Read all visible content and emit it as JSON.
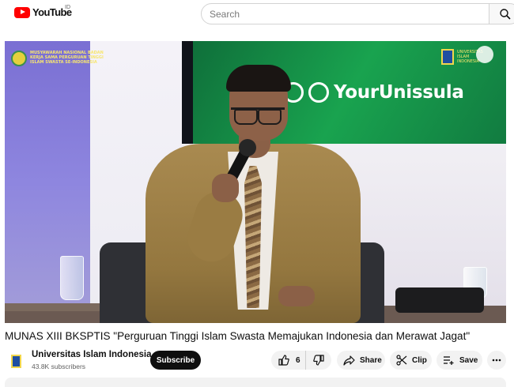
{
  "header": {
    "logo_text": "YouTube",
    "region": "ID",
    "search_placeholder": "Search"
  },
  "video": {
    "overlay_left_text": "MUSYAWARAH NASIONAL BADAN KERJA SAMA PERGURUAN TINGGI ISLAM SWASTA SE-INDONESIA",
    "overlay_right_text": "UNIVERSITAS ISLAM INDONESIA",
    "screen_brand": "YourUnissula"
  },
  "title": "MUNAS XIII BKSPTIS \"Perguruan Tinggi Islam Swasta Memajukan Indonesia dan Merawat Jagat\"",
  "channel": {
    "name": "Universitas Islam Indonesia",
    "subscribers": "43.8K subscribers",
    "subscribe_label": "Subscribe"
  },
  "actions": {
    "like_count": "6",
    "share_label": "Share",
    "clip_label": "Clip",
    "save_label": "Save"
  },
  "colors": {
    "brand_red": "#ff0000",
    "screen_green": "#19a34f",
    "subscribe_bg": "#0f0f0f"
  }
}
